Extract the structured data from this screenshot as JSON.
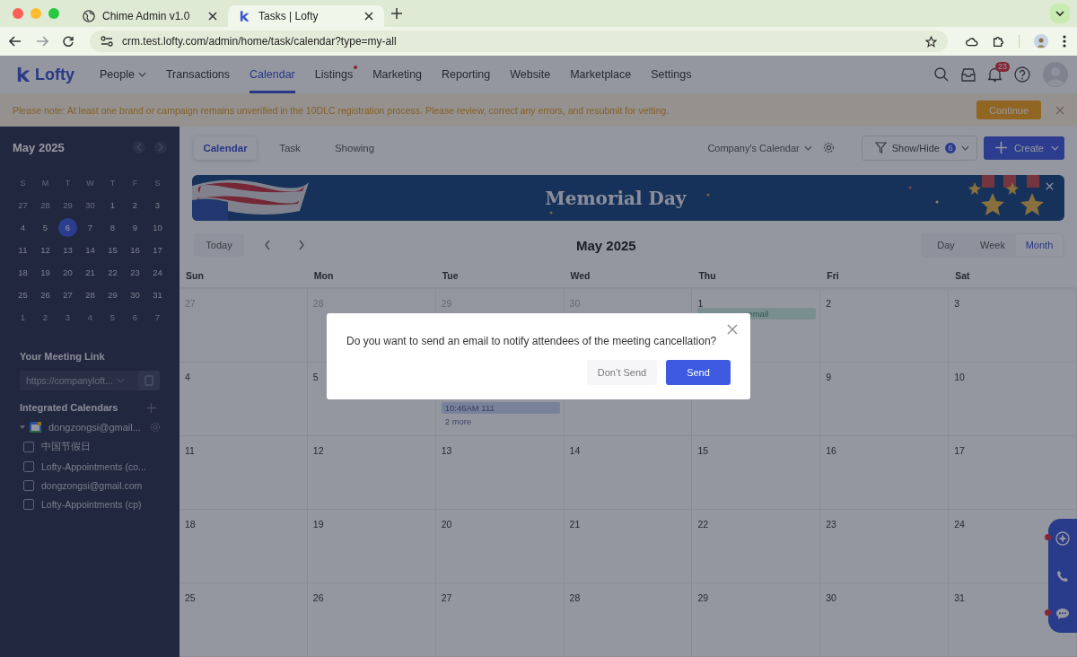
{
  "browser": {
    "tabs": [
      {
        "title": "Chime Admin v1.0",
        "selected": false
      },
      {
        "title": "Tasks | Lofty",
        "selected": true
      }
    ],
    "url": "crm.test.lofty.com/admin/home/task/calendar?type=my-all"
  },
  "app": {
    "logo": "Lofty",
    "nav": [
      {
        "label": "People",
        "selected": false,
        "dropdown": true,
        "dot": false
      },
      {
        "label": "Transactions",
        "selected": false,
        "dropdown": false,
        "dot": false
      },
      {
        "label": "Calendar",
        "selected": true,
        "dropdown": false,
        "dot": false
      },
      {
        "label": "Listings",
        "selected": false,
        "dropdown": false,
        "dot": true
      },
      {
        "label": "Marketing",
        "selected": false,
        "dropdown": false,
        "dot": false
      },
      {
        "label": "Reporting",
        "selected": false,
        "dropdown": false,
        "dot": false
      },
      {
        "label": "Website",
        "selected": false,
        "dropdown": false,
        "dot": false
      },
      {
        "label": "Marketplace",
        "selected": false,
        "dropdown": false,
        "dot": false
      },
      {
        "label": "Settings",
        "selected": false,
        "dropdown": false,
        "dot": false
      }
    ],
    "notification_count": "23"
  },
  "notice": {
    "text": "Please note: At least one brand or campaign remains unverified in the 10DLC registration process. Please review, correct any errors, and resubmit for vetting.",
    "button": "Continue"
  },
  "sidebar": {
    "mini_calendar": {
      "title": "May 2025",
      "weekdays": [
        "S",
        "M",
        "T",
        "W",
        "T",
        "F",
        "S"
      ],
      "days": [
        {
          "day": "27",
          "outside": true,
          "selected": false
        },
        {
          "day": "28",
          "outside": true,
          "selected": false
        },
        {
          "day": "29",
          "outside": true,
          "selected": false
        },
        {
          "day": "30",
          "outside": true,
          "selected": false
        },
        {
          "day": "1",
          "outside": false,
          "selected": false
        },
        {
          "day": "2",
          "outside": false,
          "selected": false
        },
        {
          "day": "3",
          "outside": false,
          "selected": false
        },
        {
          "day": "4",
          "outside": false,
          "selected": false
        },
        {
          "day": "5",
          "outside": false,
          "selected": false
        },
        {
          "day": "6",
          "outside": false,
          "selected": true
        },
        {
          "day": "7",
          "outside": false,
          "selected": false
        },
        {
          "day": "8",
          "outside": false,
          "selected": false
        },
        {
          "day": "9",
          "outside": false,
          "selected": false
        },
        {
          "day": "10",
          "outside": false,
          "selected": false
        },
        {
          "day": "11",
          "outside": false,
          "selected": false
        },
        {
          "day": "12",
          "outside": false,
          "selected": false
        },
        {
          "day": "13",
          "outside": false,
          "selected": false
        },
        {
          "day": "14",
          "outside": false,
          "selected": false
        },
        {
          "day": "15",
          "outside": false,
          "selected": false
        },
        {
          "day": "16",
          "outside": false,
          "selected": false
        },
        {
          "day": "17",
          "outside": false,
          "selected": false
        },
        {
          "day": "18",
          "outside": false,
          "selected": false
        },
        {
          "day": "19",
          "outside": false,
          "selected": false
        },
        {
          "day": "20",
          "outside": false,
          "selected": false
        },
        {
          "day": "21",
          "outside": false,
          "selected": false
        },
        {
          "day": "22",
          "outside": false,
          "selected": false
        },
        {
          "day": "23",
          "outside": false,
          "selected": false
        },
        {
          "day": "24",
          "outside": false,
          "selected": false
        },
        {
          "day": "25",
          "outside": false,
          "selected": false
        },
        {
          "day": "26",
          "outside": false,
          "selected": false
        },
        {
          "day": "27",
          "outside": false,
          "selected": false
        },
        {
          "day": "28",
          "outside": false,
          "selected": false
        },
        {
          "day": "29",
          "outside": false,
          "selected": false
        },
        {
          "day": "30",
          "outside": false,
          "selected": false
        },
        {
          "day": "31",
          "outside": false,
          "selected": false
        },
        {
          "day": "1",
          "outside": true,
          "selected": false
        },
        {
          "day": "2",
          "outside": true,
          "selected": false
        },
        {
          "day": "3",
          "outside": true,
          "selected": false
        },
        {
          "day": "4",
          "outside": true,
          "selected": false
        },
        {
          "day": "5",
          "outside": true,
          "selected": false
        },
        {
          "day": "6",
          "outside": true,
          "selected": false
        },
        {
          "day": "7",
          "outside": true,
          "selected": false
        }
      ]
    },
    "meeting_link": {
      "title": "Your Meeting Link",
      "value": "https://companyloft..."
    },
    "integrated": {
      "title": "Integrated Calendars",
      "accounts": [
        {
          "label": "dongzongsi@gmail...",
          "expanded": true,
          "children": [
            {
              "label": "中国节假日",
              "checked": false
            },
            {
              "label": "Lofty-Appointments (co...",
              "checked": false
            },
            {
              "label": "dongzongsi@gmail.com",
              "checked": false
            },
            {
              "label": "Lofty-Appointments (cp)",
              "checked": false
            }
          ]
        }
      ]
    }
  },
  "main": {
    "tabs": [
      {
        "label": "Calendar",
        "selected": true
      },
      {
        "label": "Task",
        "selected": false
      },
      {
        "label": "Showing",
        "selected": false
      }
    ],
    "calendar_select": "Company's Calendar",
    "show_hide": {
      "label": "Show/Hide",
      "count": "6"
    },
    "create": "Create",
    "banner": {
      "title": "Memorial Day"
    },
    "toolbar": {
      "today": "Today",
      "title": "May 2025",
      "views": [
        {
          "label": "Day",
          "selected": false
        },
        {
          "label": "Week",
          "selected": false
        },
        {
          "label": "Month",
          "selected": true
        }
      ]
    },
    "calendar": {
      "weekdays": [
        "Sun",
        "Mon",
        "Tue",
        "Wed",
        "Thu",
        "Fri",
        "Sat"
      ],
      "weeks": [
        [
          {
            "date": "27",
            "outside": true
          },
          {
            "date": "28",
            "outside": true
          },
          {
            "date": "29",
            "outside": true
          },
          {
            "date": "30",
            "outside": true
          },
          {
            "date": "1",
            "outside": false,
            "events": [
              {
                "text": "email",
                "kind": "chip"
              }
            ]
          },
          {
            "date": "2",
            "outside": false
          },
          {
            "date": "3",
            "outside": false
          }
        ],
        [
          {
            "date": "4",
            "outside": false
          },
          {
            "date": "5",
            "outside": false
          },
          {
            "kind": "day",
            "events": [
              {
                "text": "10:46AM 111",
                "kind": "chip-blue"
              },
              {
                "text": "2 more",
                "kind": "more"
              }
            ]
          },
          {
            "kind": "blank"
          },
          {
            "kind": "blank"
          },
          {
            "date": "9",
            "outside": false
          },
          {
            "date": "10",
            "outside": false
          }
        ],
        [
          {
            "date": "11",
            "outside": false
          },
          {
            "date": "12",
            "outside": false
          },
          {
            "date": "13",
            "outside": false
          },
          {
            "date": "14",
            "outside": false
          },
          {
            "date": "15",
            "outside": false
          },
          {
            "date": "16",
            "outside": false
          },
          {
            "date": "17",
            "outside": false
          }
        ],
        [
          {
            "date": "18",
            "outside": false
          },
          {
            "date": "19",
            "outside": false
          },
          {
            "date": "20",
            "outside": false
          },
          {
            "date": "21",
            "outside": false
          },
          {
            "date": "22",
            "outside": false
          },
          {
            "date": "23",
            "outside": false
          },
          {
            "date": "24",
            "outside": false
          }
        ],
        [
          {
            "date": "25",
            "outside": false
          },
          {
            "date": "26",
            "outside": false
          },
          {
            "date": "27",
            "outside": false
          },
          {
            "date": "28",
            "outside": false
          },
          {
            "date": "29",
            "outside": false
          },
          {
            "date": "30",
            "outside": false
          },
          {
            "date": "31",
            "outside": false
          }
        ]
      ]
    }
  },
  "dialog": {
    "message": "Do you want to send an email to notify attendees of the meeting cancellation?",
    "buttons": [
      {
        "label": "Don’t Send",
        "kind": "secondary"
      },
      {
        "label": "Send",
        "kind": "primary"
      }
    ]
  }
}
